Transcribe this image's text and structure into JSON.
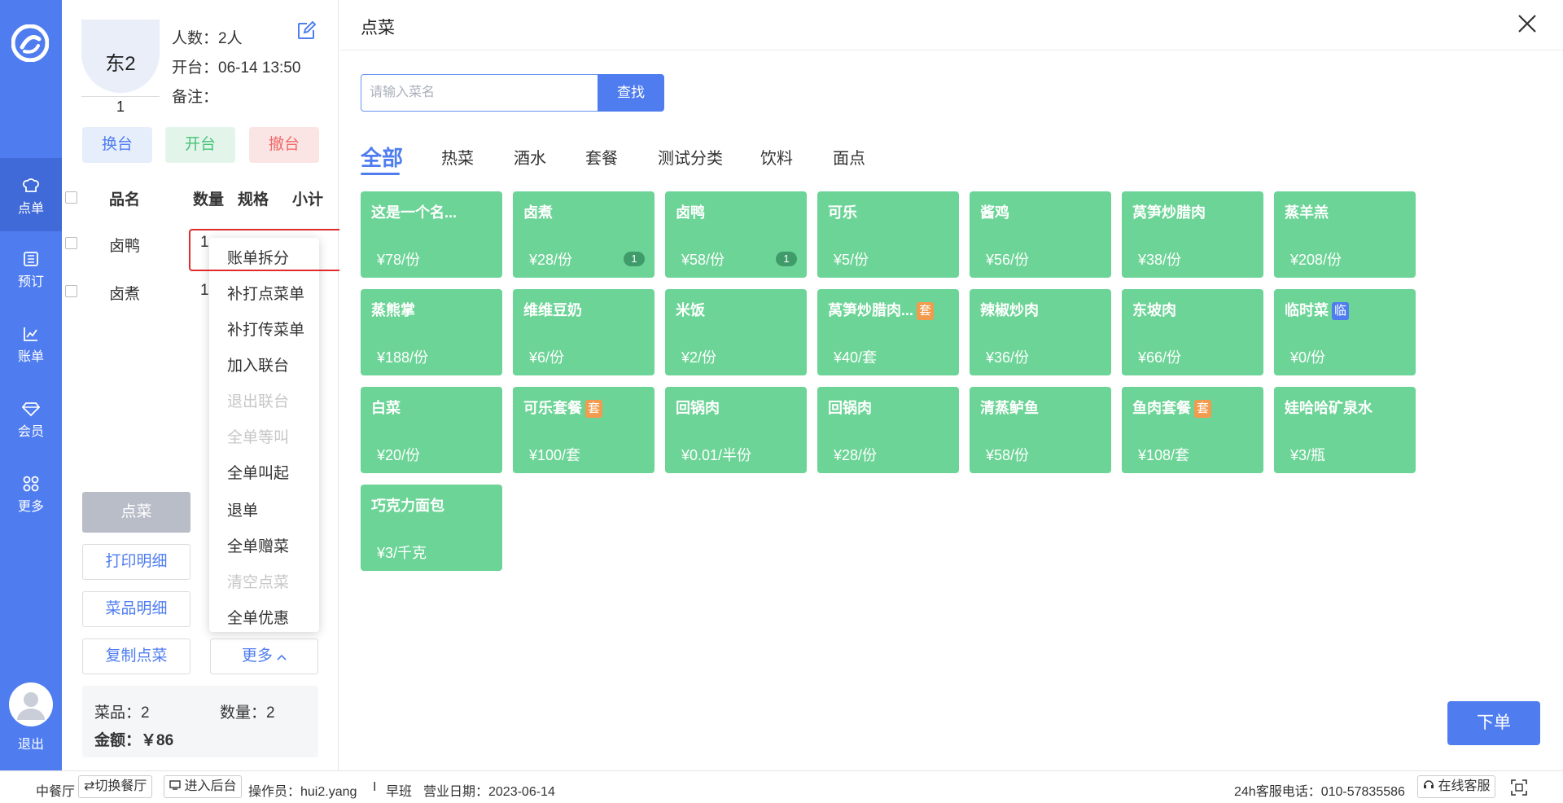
{
  "nav": {
    "items": [
      {
        "label": "点单",
        "icon": "chef-hat-icon"
      },
      {
        "label": "预订",
        "icon": "book-icon"
      },
      {
        "label": "账单",
        "icon": "chart-icon"
      },
      {
        "label": "会员",
        "icon": "diamond-icon"
      },
      {
        "label": "更多",
        "icon": "grid-icon"
      }
    ],
    "logout": "退出"
  },
  "table": {
    "name": "东2",
    "number": "1",
    "guests": "人数：2人",
    "open_time": "开台：06-14 13:50",
    "remark": "备注："
  },
  "actions": {
    "change": "换台",
    "open": "开台",
    "cancel": "撤台"
  },
  "order_table": {
    "headers": [
      "品名",
      "数量",
      "规格",
      "小计"
    ],
    "rows": [
      {
        "name": "卤鸭",
        "qty": "1"
      },
      {
        "name": "卤煮",
        "qty": "1"
      }
    ]
  },
  "menu": {
    "items": [
      {
        "label": "账单拆分",
        "disabled": false
      },
      {
        "label": "补打点菜单",
        "disabled": false
      },
      {
        "label": "补打传菜单",
        "disabled": false
      },
      {
        "label": "加入联台",
        "disabled": false
      },
      {
        "label": "退出联台",
        "disabled": true
      },
      {
        "label": "全单等叫",
        "disabled": true
      },
      {
        "label": "全单叫起",
        "disabled": false
      },
      {
        "label": "退单",
        "disabled": false
      },
      {
        "label": "全单赠菜",
        "disabled": false
      },
      {
        "label": "清空点菜",
        "disabled": true
      },
      {
        "label": "全单优惠",
        "disabled": false
      }
    ]
  },
  "buttons": {
    "order": "点菜",
    "print": "打印明细",
    "detail": "菜品明细",
    "copy": "复制点菜",
    "more": "更多"
  },
  "summary": {
    "dishes": "菜品：2",
    "count": "数量：2",
    "amount": "金额：￥86"
  },
  "main": {
    "title": "点菜",
    "search_placeholder": "请输入菜名",
    "search_button": "查找",
    "tabs": [
      "全部",
      "热菜",
      "酒水",
      "套餐",
      "测试分类",
      "饮料",
      "面点"
    ],
    "dishes": [
      {
        "name": "这是一个名...",
        "price": "¥78/份"
      },
      {
        "name": "卤煮",
        "price": "¥28/份",
        "qty": "1"
      },
      {
        "name": "卤鸭",
        "price": "¥58/份",
        "qty": "1"
      },
      {
        "name": "可乐",
        "price": "¥5/份"
      },
      {
        "name": "酱鸡",
        "price": "¥56/份"
      },
      {
        "name": "莴笋炒腊肉",
        "price": "¥38/份"
      },
      {
        "name": "蒸羊羔",
        "price": "¥208/份"
      },
      {
        "name": "蒸熊掌",
        "price": "¥188/份"
      },
      {
        "name": "维维豆奶",
        "price": "¥6/份"
      },
      {
        "name": "米饭",
        "price": "¥2/份"
      },
      {
        "name": "莴笋炒腊肉...",
        "price": "¥40/套",
        "tag": "套",
        "tag_type": "set"
      },
      {
        "name": "辣椒炒肉",
        "price": "¥36/份"
      },
      {
        "name": "东坡肉",
        "price": "¥66/份"
      },
      {
        "name": "临时菜",
        "price": "¥0/份",
        "tag": "临",
        "tag_type": "temp"
      },
      {
        "name": "白菜",
        "price": "¥20/份"
      },
      {
        "name": "可乐套餐",
        "price": "¥100/套",
        "tag": "套",
        "tag_type": "set"
      },
      {
        "name": "回锅肉",
        "price": "¥0.01/半份"
      },
      {
        "name": "回锅肉",
        "price": "¥28/份"
      },
      {
        "name": "清蒸鲈鱼",
        "price": "¥58/份"
      },
      {
        "name": "鱼肉套餐",
        "price": "¥108/套",
        "tag": "套",
        "tag_type": "set"
      },
      {
        "name": "娃哈哈矿泉水",
        "price": "¥3/瓶"
      },
      {
        "name": "巧克力面包",
        "price": "¥3/千克"
      }
    ],
    "submit": "下单"
  },
  "statusbar": {
    "restaurant": "中餐厅",
    "switch": "⇄切换餐厅",
    "backend": "进入后台",
    "operator": "操作员：hui2.yang",
    "sep": "I",
    "shift": "早班",
    "business_date": "营业日期：2023-06-14",
    "hotline": "24h客服电话：010-57835586",
    "online": "在线客服"
  },
  "colors": {
    "primary": "#4f7df0",
    "dish": "#6cd496",
    "set_tag": "#f29b4e"
  }
}
